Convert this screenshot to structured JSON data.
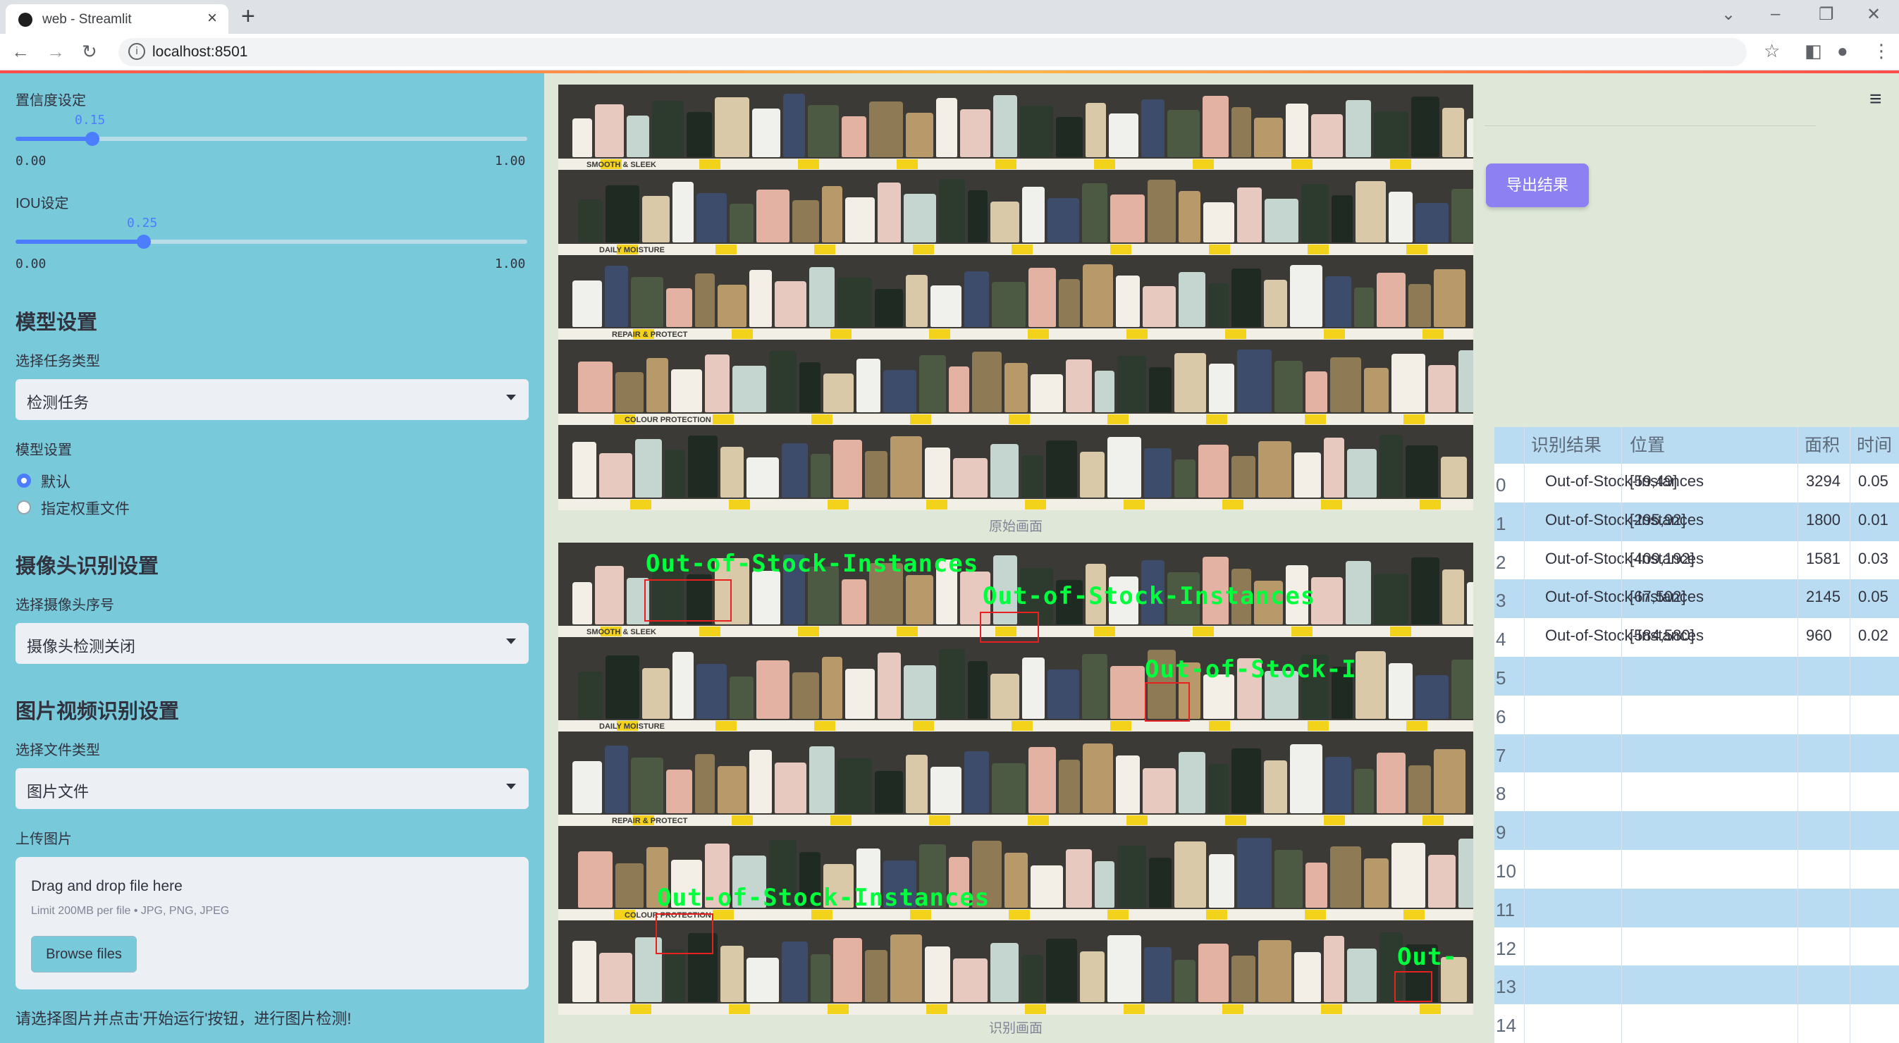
{
  "browser": {
    "tab_title": "web - Streamlit",
    "url": "localhost:8501"
  },
  "sidebar": {
    "confidence": {
      "label": "置信度设定",
      "value": "0.15",
      "value_fraction": 0.15,
      "min": "0.00",
      "max": "1.00"
    },
    "iou": {
      "label": "IOU设定",
      "value": "0.25",
      "value_fraction": 0.25,
      "min": "0.00",
      "max": "1.00"
    },
    "model_section": {
      "heading": "模型设置",
      "task_label": "选择任务类型",
      "task_value": "检测任务",
      "model_label": "模型设置",
      "options": [
        "默认",
        "指定权重文件"
      ],
      "selected_option": "默认"
    },
    "camera_section": {
      "heading": "摄像头识别设置",
      "camera_label": "选择摄像头序号",
      "camera_value": "摄像头检测关闭"
    },
    "media_section": {
      "heading": "图片视频识别设置",
      "file_type_label": "选择文件类型",
      "file_type_value": "图片文件",
      "upload_label": "上传图片",
      "drop_title": "Drag and drop file here",
      "drop_limit": "Limit 200MB per file • JPG, PNG, JPEG",
      "browse_label": "Browse files"
    },
    "hint": "请选择图片并点击'开始运行'按钮，进行图片检测!"
  },
  "main": {
    "original_caption": "原始画面",
    "result_caption": "识别画面",
    "detections": [
      {
        "label": "Out-of-Stock-Instances"
      },
      {
        "label": "Out-of-Stock-Instances"
      },
      {
        "label": "Out-of-Stock-I"
      },
      {
        "label": "Out-of-Stock-Instances"
      },
      {
        "label": "Out-"
      }
    ],
    "shelf_strips": [
      "SMOOTH & SLEEK",
      "DAILY MOISTURE",
      "REPAIR & PROTECT",
      "COLOUR PROTECTION"
    ]
  },
  "results": {
    "export_label": "导出结果",
    "columns": [
      "识别结果",
      "位置",
      "面积",
      "时间"
    ],
    "rows": [
      {
        "index": "0",
        "result": "Out-of-Stock-Instances",
        "position": "[59,49]",
        "area": "3294",
        "time": "0.05"
      },
      {
        "index": "1",
        "result": "Out-of-Stock-Instances",
        "position": "[295,92]",
        "area": "1800",
        "time": "0.01"
      },
      {
        "index": "2",
        "result": "Out-of-Stock-Instances",
        "position": "[409,192]",
        "area": "1581",
        "time": "0.03"
      },
      {
        "index": "3",
        "result": "Out-of-Stock-Instances",
        "position": "[67,502]",
        "area": "2145",
        "time": "0.05"
      },
      {
        "index": "4",
        "result": "Out-of-Stock-Instances",
        "position": "[584,580]",
        "area": "960",
        "time": "0.02"
      },
      {
        "index": "5"
      },
      {
        "index": "6"
      },
      {
        "index": "7"
      },
      {
        "index": "8"
      },
      {
        "index": "9"
      },
      {
        "index": "10"
      },
      {
        "index": "11"
      },
      {
        "index": "12"
      },
      {
        "index": "13"
      },
      {
        "index": "14"
      }
    ]
  }
}
